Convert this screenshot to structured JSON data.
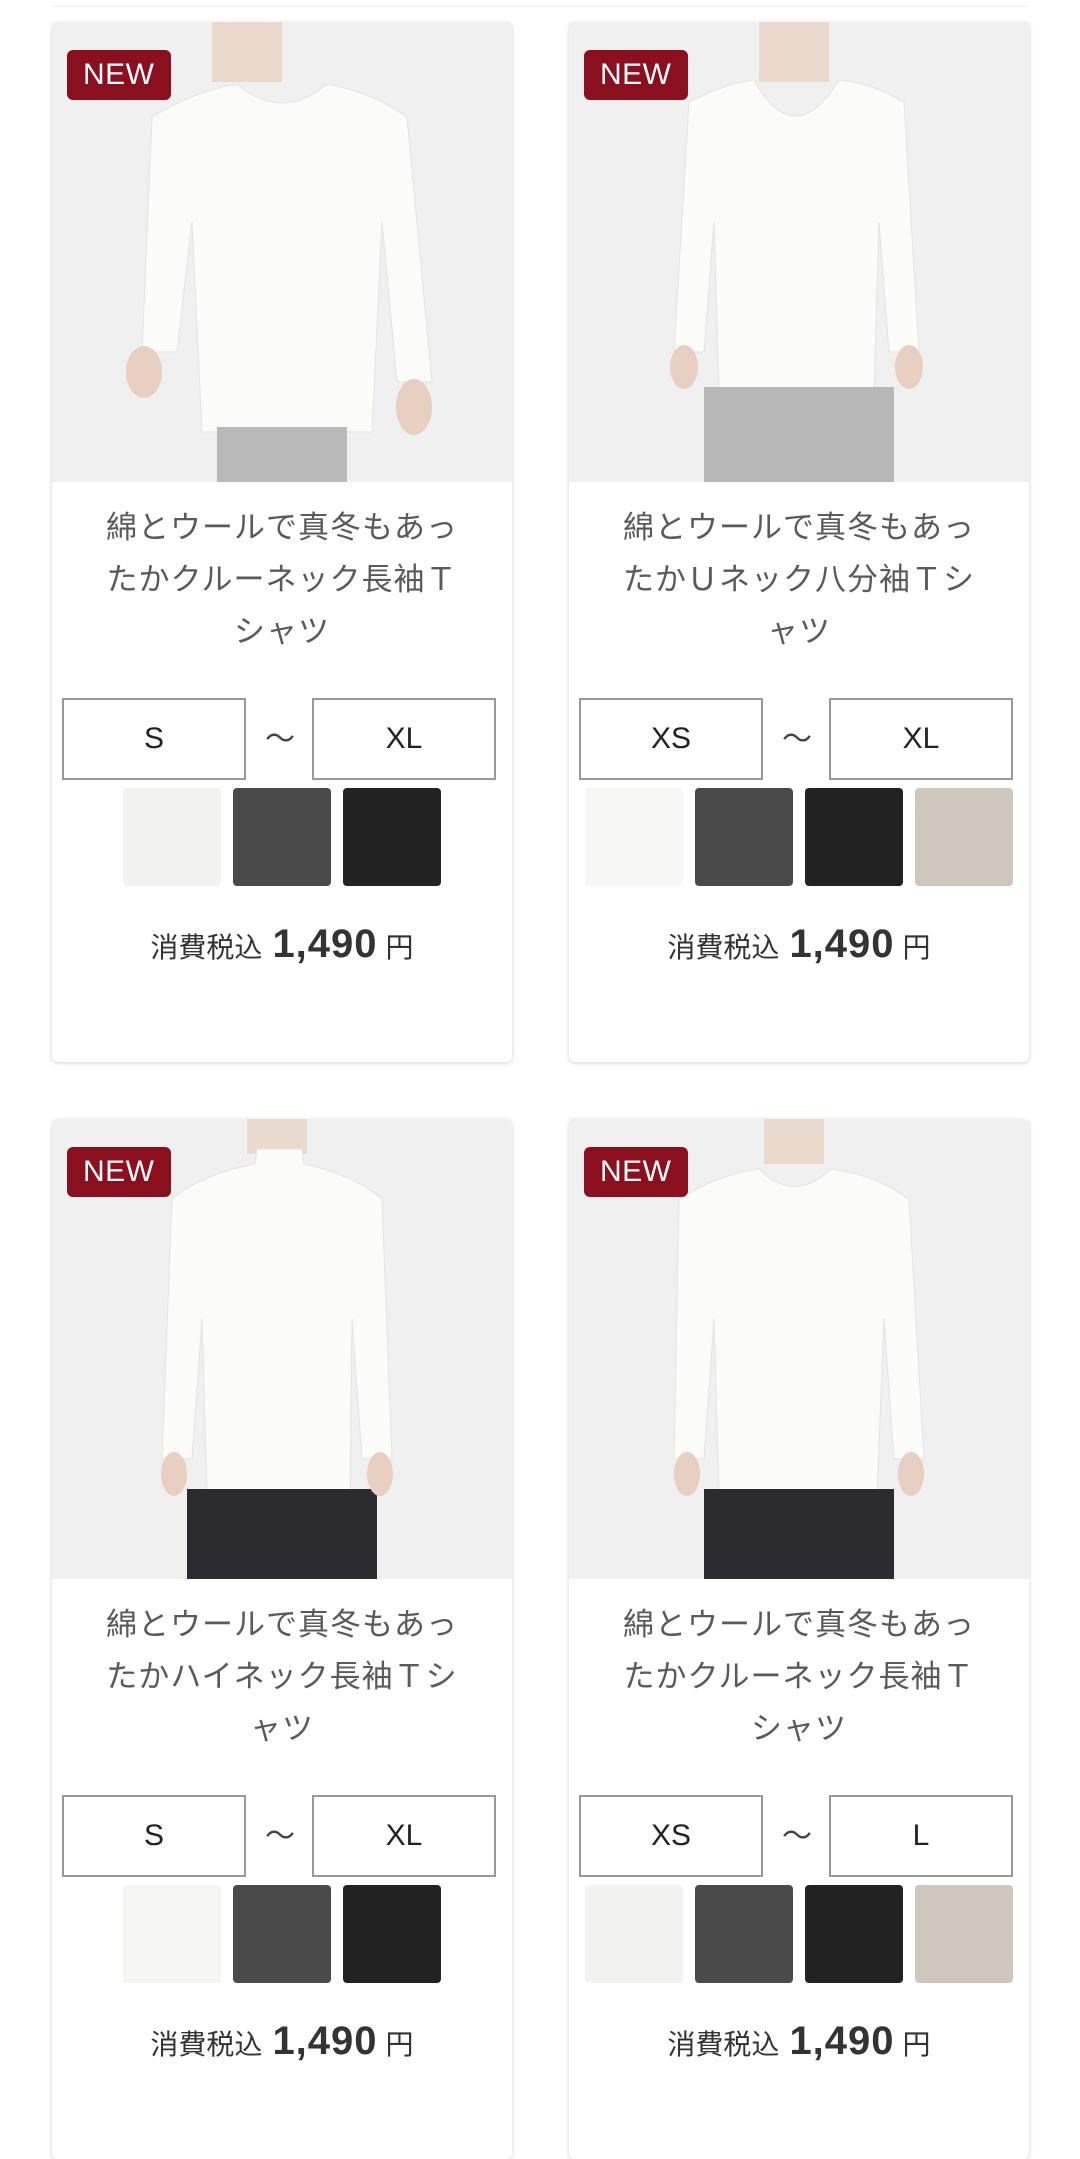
{
  "colors": {
    "badge_bg": "#8a0f1f",
    "off_white": "#f2f2f0",
    "charcoal": "#4a4a4a",
    "black": "#222222",
    "oatmeal": "#cfc7bd"
  },
  "products": [
    {
      "badge": "NEW",
      "title_line1": "綿とウールで真冬もあっ",
      "title_line2": "たかクルーネック長袖Ｔ",
      "title_line3": "シャツ",
      "size_min": "S",
      "size_sep": "〜",
      "size_max": "XL",
      "swatches": [
        "#f2f2f0",
        "#4a4a4a",
        "#222222"
      ],
      "price_tax_label": "消費税込",
      "price": "1,490",
      "currency": "円",
      "model": "male-crew"
    },
    {
      "badge": "NEW",
      "title_line1": "綿とウールで真冬もあっ",
      "title_line2": "たかＵネック八分袖Ｔシ",
      "title_line3": "ャツ",
      "size_min": "XS",
      "size_sep": "〜",
      "size_max": "XL",
      "swatches": [
        "#f7f7f5",
        "#4a4a4a",
        "#222222",
        "#cfc7bd"
      ],
      "price_tax_label": "消費税込",
      "price": "1,490",
      "currency": "円",
      "model": "female-u"
    },
    {
      "badge": "NEW",
      "title_line1": "綿とウールで真冬もあっ",
      "title_line2": "たかハイネック長袖Ｔシ",
      "title_line3": "ャツ",
      "size_min": "S",
      "size_sep": "〜",
      "size_max": "XL",
      "swatches": [
        "#f5f5f2",
        "#4a4a4a",
        "#222222"
      ],
      "price_tax_label": "消費税込",
      "price": "1,490",
      "currency": "円",
      "model": "female-high"
    },
    {
      "badge": "NEW",
      "title_line1": "綿とウールで真冬もあっ",
      "title_line2": "たかクルーネック長袖Ｔ",
      "title_line3": "シャツ",
      "size_min": "XS",
      "size_sep": "〜",
      "size_max": "L",
      "swatches": [
        "#f2f2f0",
        "#4a4a4a",
        "#222222",
        "#cfc7bd"
      ],
      "price_tax_label": "消費税込",
      "price": "1,490",
      "currency": "円",
      "model": "female-crew"
    }
  ]
}
